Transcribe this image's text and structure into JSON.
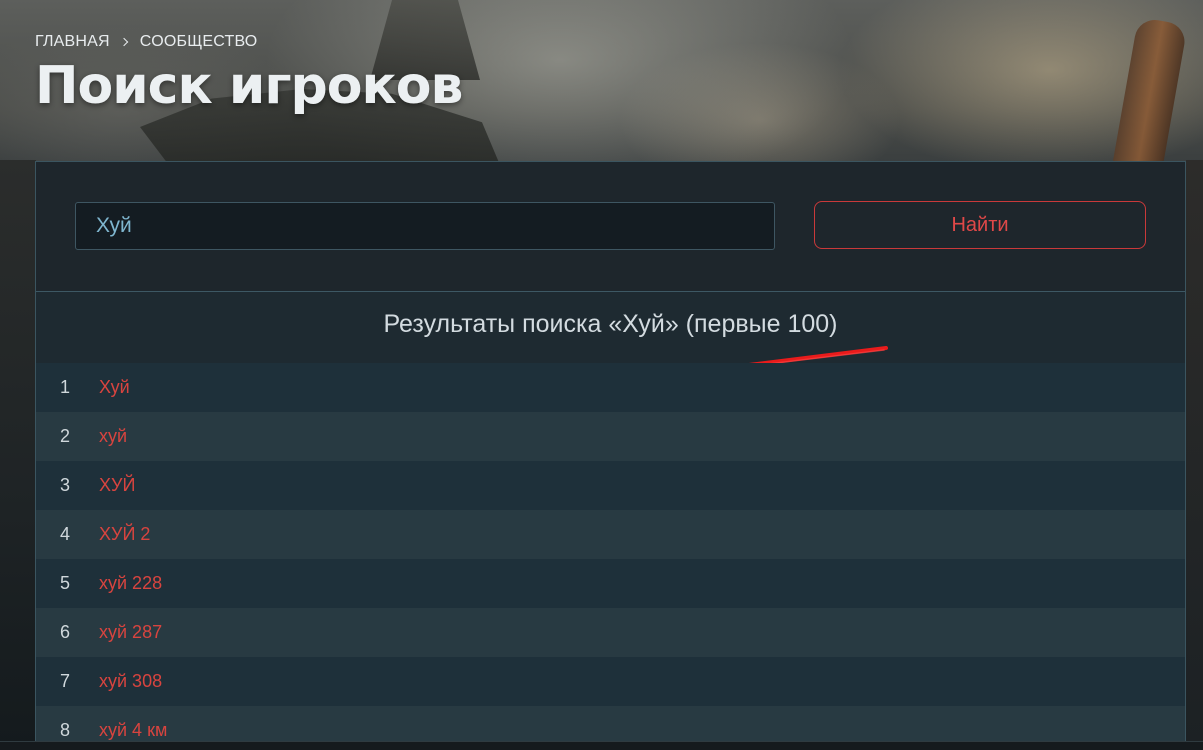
{
  "breadcrumb": {
    "home": "ГЛАВНАЯ",
    "section": "СООБЩЕСТВО"
  },
  "page_title": "Поиск игроков",
  "search": {
    "value": "Хуй",
    "button_label": "Найти"
  },
  "results": {
    "title": "Результаты поиска «Хуй» (первые 100)",
    "items": [
      {
        "index": "1",
        "name": "Хуй"
      },
      {
        "index": "2",
        "name": "хуй"
      },
      {
        "index": "3",
        "name": "ХУЙ"
      },
      {
        "index": "4",
        "name": "ХУЙ 2"
      },
      {
        "index": "5",
        "name": "хуй 228"
      },
      {
        "index": "6",
        "name": "хуй 287"
      },
      {
        "index": "7",
        "name": "хуй 308"
      },
      {
        "index": "8",
        "name": "хуй 4 км"
      }
    ]
  },
  "colors": {
    "accent_red": "#d8443f",
    "button_border": "#c9393a",
    "input_text": "#7fb6cf",
    "annotation_red": "#ff1a1a"
  }
}
